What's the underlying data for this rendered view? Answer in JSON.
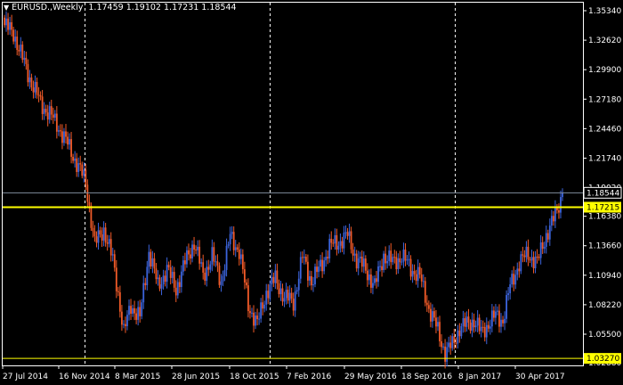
{
  "header": {
    "symbol": "EURUSD.,Weekly",
    "ohlc": "1.17459 1.19102 1.17231 1.18544"
  },
  "colors": {
    "background": "#000000",
    "bull": "#3c64dc",
    "bear": "#f05a28",
    "axis": "#ffffff",
    "grid": "#ffffff",
    "hline": "#ffff00",
    "bid_line": "#7f8c9c"
  },
  "price_axis": {
    "min": 1.0287,
    "max": 1.3534,
    "ticks": [
      "1.35340",
      "1.32620",
      "1.29900",
      "1.27180",
      "1.24460",
      "1.21740",
      "1.19020",
      "1.16380",
      "1.13660",
      "1.10940",
      "1.08220",
      "1.05500",
      "1.02880"
    ]
  },
  "time_axis": {
    "labels": [
      "27 Jul 2014",
      "16 Nov 2014",
      "8 Mar 2015",
      "28 Jun 2015",
      "18 Oct 2015",
      "7 Feb 2016",
      "29 May 2016",
      "18 Sep 2016",
      "8 Jan 2017",
      "30 Apr 2017"
    ]
  },
  "levels": [
    {
      "name": "current-price",
      "value": 1.18544,
      "label": "1.18544"
    },
    {
      "name": "horizontal-line",
      "value": 1.17215,
      "label": "1.17215"
    },
    {
      "name": "low-line",
      "value": 1.0327,
      "label": "1.03270"
    }
  ],
  "chart_data": {
    "type": "candlestick",
    "title": "EURUSD.,Weekly",
    "ylim": [
      1.0287,
      1.3534
    ],
    "series": [
      {
        "date": "27 Jul 2014",
        "close": 1.34
      },
      {
        "date": "16 Nov 2014",
        "close": 1.248
      },
      {
        "date": "8 Mar 2015",
        "close": 1.088
      },
      {
        "date": "28 Jun 2015",
        "close": 1.115
      },
      {
        "date": "18 Oct 2015",
        "close": 1.134
      },
      {
        "date": "7 Feb 2016",
        "close": 1.119
      },
      {
        "date": "29 May 2016",
        "close": 1.114
      },
      {
        "date": "18 Sep 2016",
        "close": 1.116
      },
      {
        "date": "8 Jan 2017",
        "close": 1.053
      },
      {
        "date": "30 Apr 2017",
        "close": 1.092
      },
      {
        "date": "last",
        "close": 1.18544
      }
    ]
  }
}
